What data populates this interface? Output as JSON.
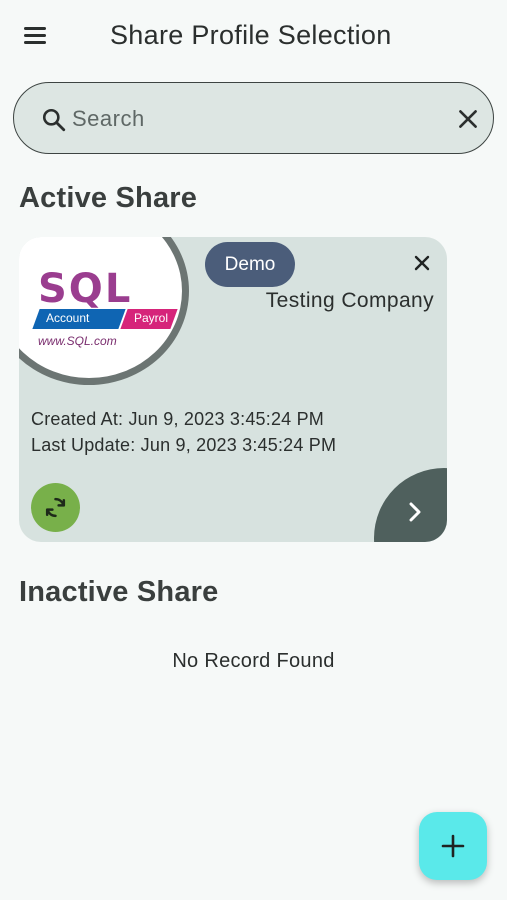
{
  "header": {
    "title": "Share Profile Selection",
    "menu_icon": "menu-icon"
  },
  "search": {
    "placeholder": "Search",
    "value": ""
  },
  "active_section": {
    "title": "Active Share"
  },
  "card": {
    "logo": {
      "brand": "SQL",
      "tag_left": "Account",
      "tag_right": "Payrol",
      "url": "www.SQL.com"
    },
    "badge": "Demo",
    "company": "Testing Company",
    "created_at": "Created At: Jun 9, 2023 3:45:24 PM",
    "last_update": "Last Update: Jun 9, 2023 3:45:24 PM"
  },
  "inactive_section": {
    "title": "Inactive Share",
    "empty_text": "No Record Found"
  },
  "colors": {
    "background": "#f6f9f8",
    "card": "#d7e2df",
    "badge": "#4b5d7a",
    "sync": "#78b04a",
    "next": "#4f605d",
    "fab": "#5ae9ea"
  }
}
